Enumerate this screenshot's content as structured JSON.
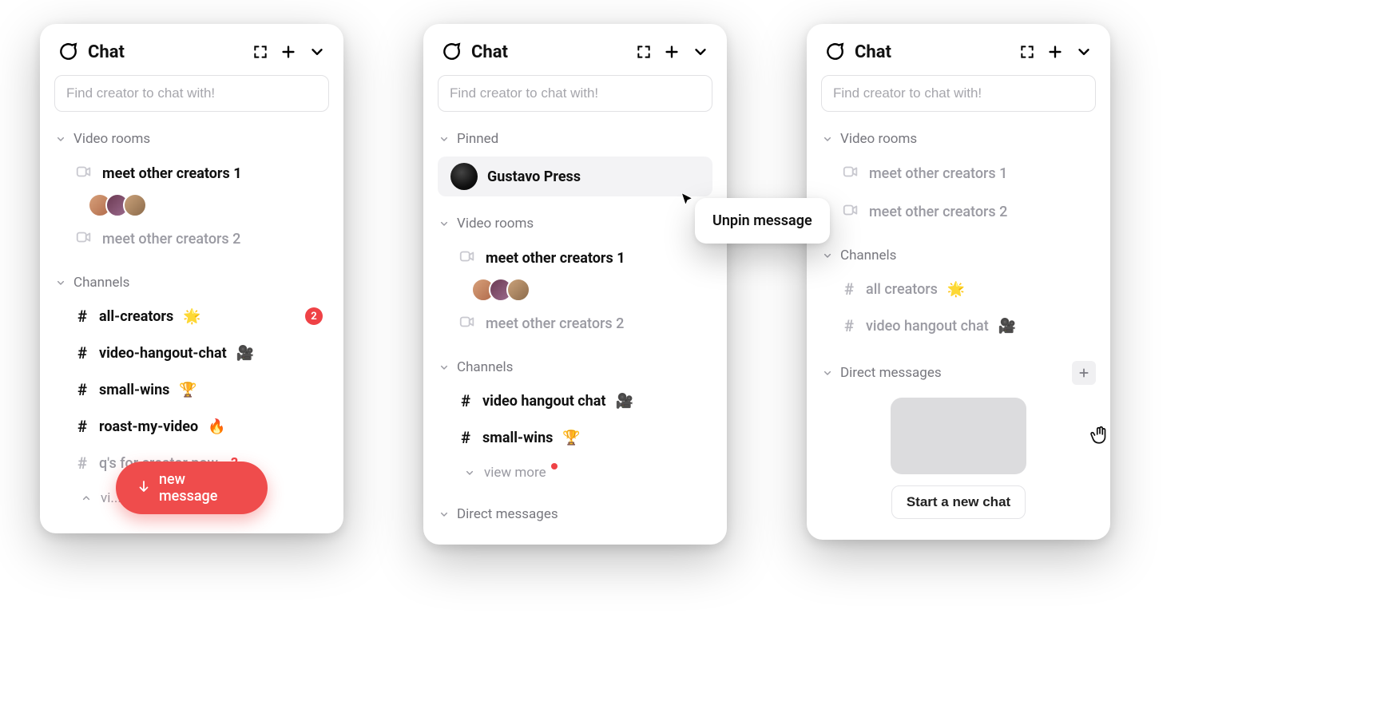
{
  "header": {
    "title": "Chat"
  },
  "search": {
    "placeholder": "Find creator to chat with!"
  },
  "panel1": {
    "sections": {
      "video_rooms": {
        "label": "Video rooms",
        "items": [
          {
            "label": "meet other creators 1",
            "active": true,
            "avatars": [
              "#c38a6a",
              "#8a4b6b",
              "#b99a7c"
            ]
          },
          {
            "label": "meet other creators 2",
            "muted": true
          }
        ]
      },
      "channels": {
        "label": "Channels",
        "items": [
          {
            "label": "all-creators",
            "emoji": "🌟",
            "badge": "2"
          },
          {
            "label": "video-hangout-chat",
            "emoji": "🎥"
          },
          {
            "label": "small-wins",
            "emoji": "🏆"
          },
          {
            "label": "roast-my-video",
            "emoji": "🔥"
          },
          {
            "label": "q's for creator now",
            "muted": true,
            "red_q": "?"
          }
        ],
        "view_more_truncated": "vi..."
      }
    },
    "new_message_label": "new message"
  },
  "panel2": {
    "sections": {
      "pinned": {
        "label": "Pinned",
        "items": [
          {
            "label": "Gustavo Press"
          }
        ]
      },
      "video_rooms": {
        "label": "Video rooms",
        "items": [
          {
            "label": "meet other creators 1",
            "active": true,
            "avatars": [
              "#c38a6a",
              "#8a4b6b",
              "#b99a7c"
            ]
          },
          {
            "label": "meet other creators 2",
            "muted": true
          }
        ]
      },
      "channels": {
        "label": "Channels",
        "items": [
          {
            "label": "video hangout chat",
            "emoji": "🎥"
          },
          {
            "label": "small-wins",
            "emoji": "🏆"
          }
        ],
        "view_more": "view more"
      },
      "direct_messages": {
        "label": "Direct messages"
      }
    },
    "context_menu": {
      "label": "Unpin message"
    }
  },
  "panel3": {
    "sections": {
      "video_rooms": {
        "label": "Video rooms",
        "items": [
          {
            "label": "meet other creators 1",
            "muted": true
          },
          {
            "label": "meet other creators 2",
            "muted": true
          }
        ]
      },
      "channels": {
        "label": "Channels",
        "items": [
          {
            "label": "all creators",
            "emoji": "🌟",
            "muted": true
          },
          {
            "label": "video hangout chat",
            "emoji": "🎥",
            "muted": true
          }
        ]
      },
      "direct_messages": {
        "label": "Direct messages"
      }
    },
    "start_chat_label": "Start a new chat"
  }
}
